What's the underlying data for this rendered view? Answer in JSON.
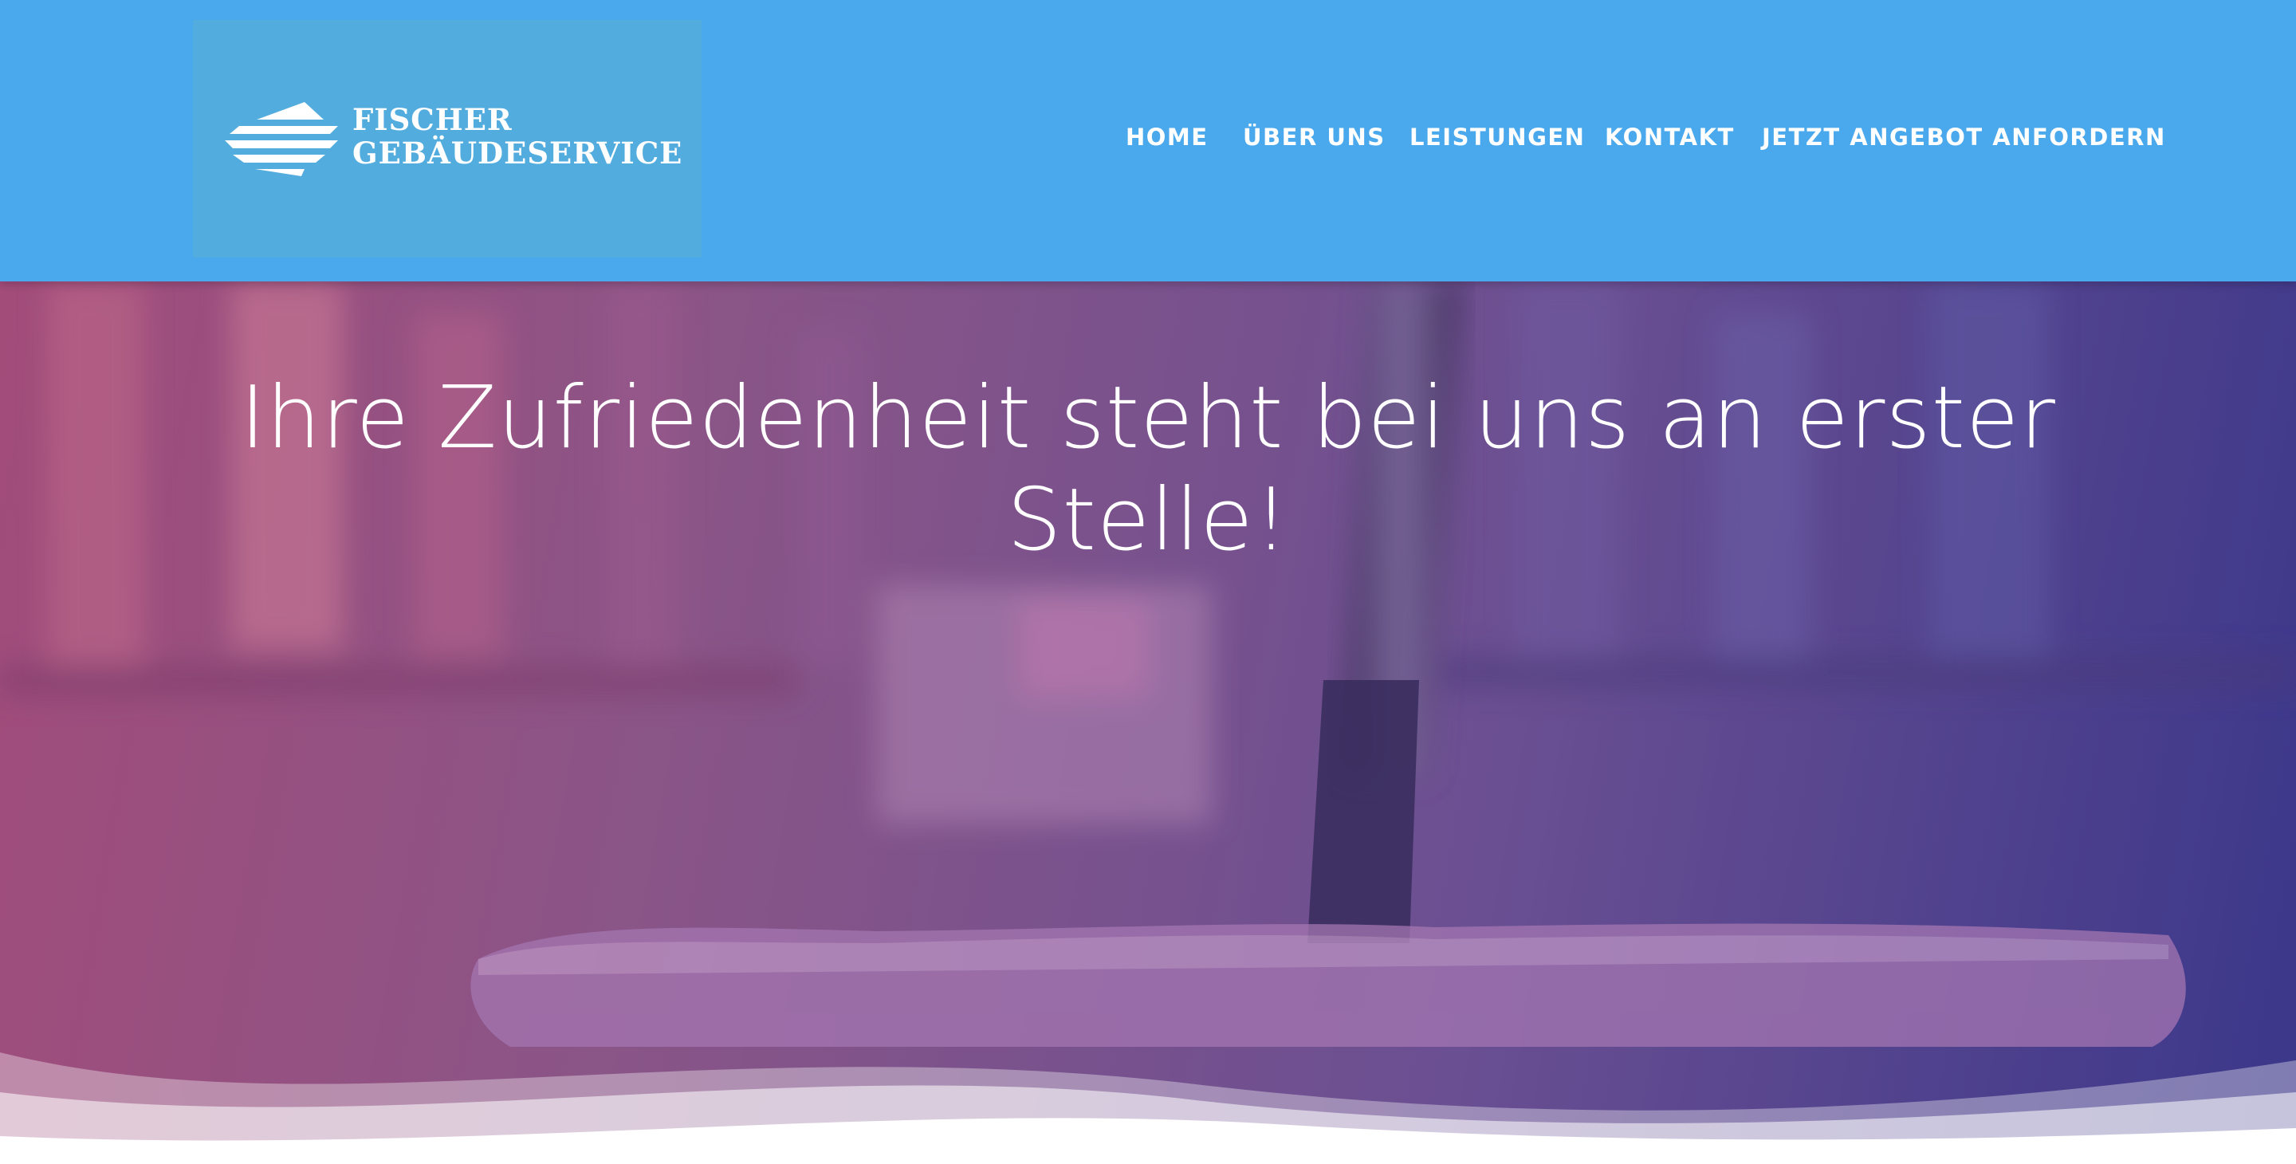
{
  "brand": {
    "name_line1": "FISCHER",
    "name_line2": "GEBÄUDESERVICE",
    "logo_icon": "diamond-stripes-logo-icon",
    "header_color": "#4aa8ec",
    "logo_box_color": "#52acde"
  },
  "nav": {
    "items": [
      {
        "label": "HOME"
      },
      {
        "label": "ÜBER UNS"
      },
      {
        "label": "LEISTUNGEN"
      },
      {
        "label": "KONTAKT"
      },
      {
        "label": "JETZT ANGEBOT ANFORDERN"
      }
    ]
  },
  "hero": {
    "title": "Ihre Zufriedenheit steht bei uns an erster Stelle!",
    "background_image": "mop-cleaning-floor-photo",
    "gradient_colors": [
      "#a24c7a",
      "#6a4f92",
      "#3b378a"
    ]
  }
}
